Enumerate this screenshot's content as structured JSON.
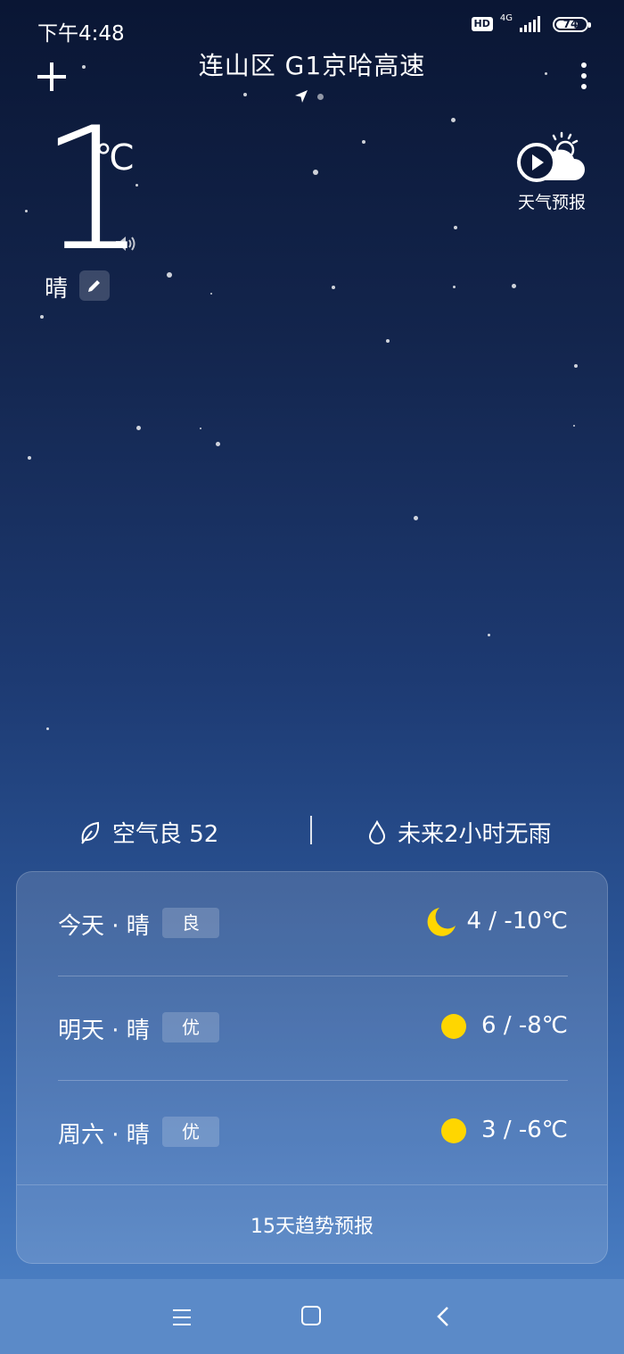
{
  "status_bar": {
    "time": "下午4:48",
    "hd_label": "HD",
    "network_label": "4G",
    "battery_level": "74",
    "battery_fraction": 0.74
  },
  "header": {
    "location": "连山区  G1京哈高速",
    "add_icon": "plus-icon",
    "more_icon": "more-vertical-icon"
  },
  "current": {
    "temperature": "1",
    "unit": "℃",
    "condition": "晴",
    "forecast_video_label": "天气预报"
  },
  "info": {
    "air_quality": "空气良 52",
    "rain": "未来2小时无雨"
  },
  "forecast": [
    {
      "day": "今天 · 晴",
      "aqi": "良",
      "icon": "moon-icon",
      "temp": "4 / -10℃"
    },
    {
      "day": "明天 · 晴",
      "aqi": "优",
      "icon": "sun-icon",
      "temp": "6 / -8℃"
    },
    {
      "day": "周六 · 晴",
      "aqi": "优",
      "icon": "sun-icon",
      "temp": "3 / -6℃"
    }
  ],
  "trend_label": "15天趋势预报",
  "colors": {
    "sun": "#ffd600",
    "background_top": "#0a1634",
    "background_bottom": "#5286c8"
  }
}
